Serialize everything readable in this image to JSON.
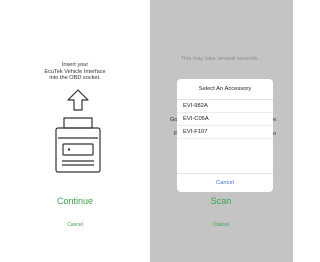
{
  "left": {
    "instruction_lines": [
      "Insert your",
      "EcuTek Vehicle Interface",
      "into the OBD socket."
    ],
    "continue_label": "Continue",
    "cancel_label": "Cancel"
  },
  "right": {
    "wait_text": "This may take several seconds...",
    "partial_text": [
      "Go",
      "e.",
      "P",
      "o"
    ],
    "scan_label": "Scan",
    "cancel_label": "Cancel"
  },
  "dialog": {
    "title": "Select An Accessory",
    "options": [
      "EVI-982A",
      "EVI-C05A",
      "EVI-F107"
    ],
    "cancel_label": "Cancel"
  },
  "colors": {
    "accent_green": "#3aa14a",
    "dialog_link": "#3b6fd2",
    "overlay_grey": "#c4c4c4"
  }
}
